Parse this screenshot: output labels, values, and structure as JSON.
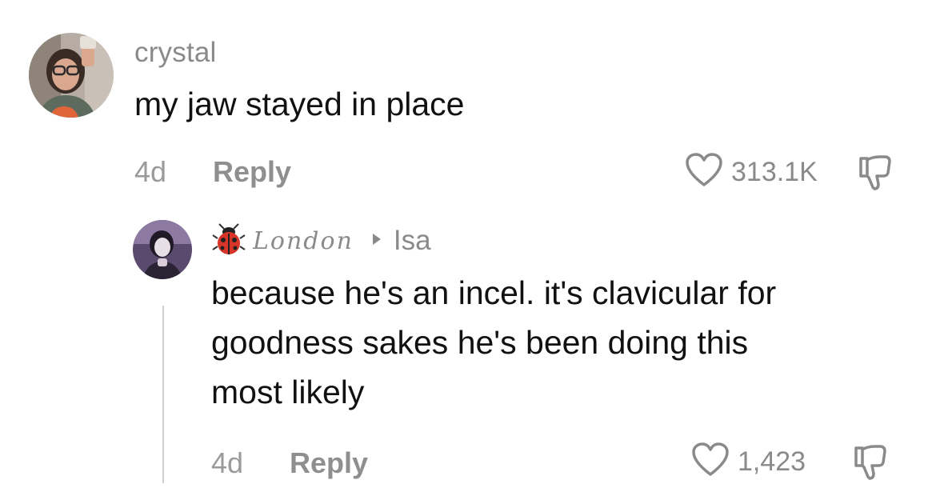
{
  "comment": {
    "username": "crystal",
    "text": "my jaw stayed in place",
    "age": "4d",
    "reply_label": "Reply",
    "like_count": "313.1K"
  },
  "reply": {
    "username": "London",
    "reply_to": "Isa",
    "text_lines": [
      "because he's an incel. it's clavicular for",
      "goodness sakes he's been doing this",
      "most likely"
    ],
    "age": "4d",
    "reply_label": "Reply",
    "like_count": "1,423"
  },
  "icons": {
    "like": "heart-outline-icon",
    "dislike": "thumbs-down-icon",
    "reply_to": "triangle-right-icon",
    "name_emoji": "ladybug-icon"
  },
  "colors": {
    "text": "#111111",
    "muted": "#8a8a8a",
    "thread_line": "#cfcfcf"
  }
}
